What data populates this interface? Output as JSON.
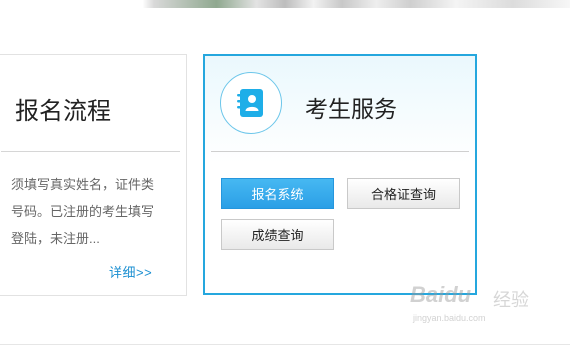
{
  "left_card": {
    "title": "报名流程",
    "description": "须填写真实姓名，证件类号码。已注册的考生填写登陆，未注册...",
    "more_link": "详细>>"
  },
  "right_card": {
    "icon": "address-book-icon",
    "title": "考生服务",
    "buttons": {
      "register": "报名系统",
      "certificate": "合格证查询",
      "score": "成绩查询"
    }
  },
  "watermark": {
    "brand": "Baidu",
    "label": "经验",
    "url": "jingyan.baidu.com"
  },
  "colors": {
    "accent": "#25a7de",
    "primary_button": "#2b9fe6",
    "link": "#1b8fd1"
  }
}
